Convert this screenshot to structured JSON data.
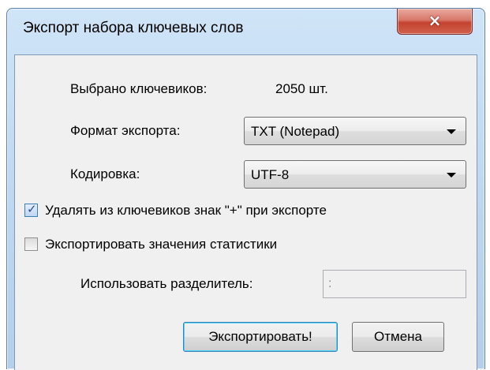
{
  "window": {
    "title": "Экспорт набора ключевых слов",
    "close_icon": "×"
  },
  "form": {
    "selected_label": "Выбрано ключевиков:",
    "selected_value": "2050 шт.",
    "format_label": "Формат экспорта:",
    "format_value": "TXT (Notepad)",
    "encoding_label": "Кодировка:",
    "encoding_value": "UTF-8",
    "remove_plus_label": "Удалять из ключевиков знак \"+\" при экспорте",
    "remove_plus_checked": true,
    "export_stats_label": "Экспортировать значения статистики",
    "export_stats_checked": false,
    "separator_label": "Использовать разделитель:",
    "separator_value": ":"
  },
  "buttons": {
    "export_label": "Экспортировать!",
    "cancel_label": "Отмена"
  },
  "icons": {
    "close": "close-icon",
    "combo_arrow": "chevron-down-icon",
    "checkmark": "checkmark-icon"
  },
  "colors": {
    "titlebar": "#bcd6ef",
    "close_button": "#c4432f",
    "client_background": "#f0f0f0",
    "default_button_border": "#3c7fb1"
  }
}
